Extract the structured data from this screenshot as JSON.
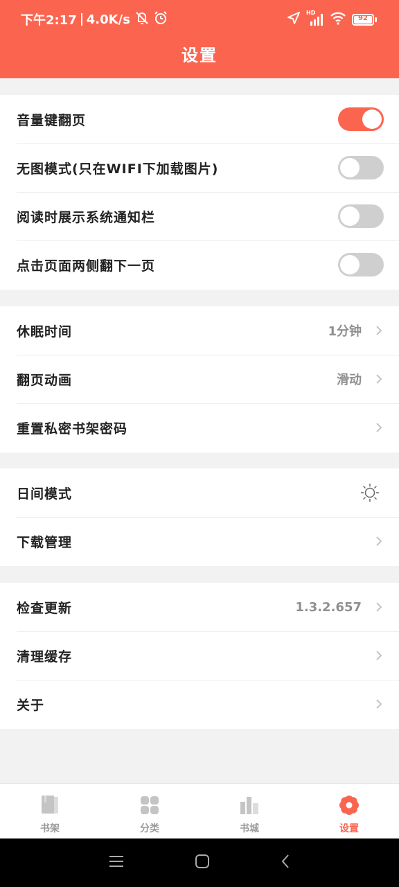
{
  "status_bar": {
    "time": "下午2:17",
    "speed": "4.0K/s",
    "network": "HD",
    "battery": "92"
  },
  "header": {
    "title": "设置"
  },
  "groups": [
    {
      "rows": [
        {
          "label": "音量键翻页",
          "toggle": true
        },
        {
          "label": "无图模式(只在WIFI下加载图片)",
          "toggle": false
        },
        {
          "label": "阅读时展示系统通知栏",
          "toggle": false
        },
        {
          "label": "点击页面两侧翻下一页",
          "toggle": false
        }
      ]
    },
    {
      "rows": [
        {
          "label": "休眠时间",
          "value": "1分钟"
        },
        {
          "label": "翻页动画",
          "value": "滑动"
        },
        {
          "label": "重置私密书架密码"
        }
      ]
    },
    {
      "rows": [
        {
          "label": "日间模式",
          "icon": "sun-icon"
        },
        {
          "label": "下载管理"
        }
      ]
    },
    {
      "rows": [
        {
          "label": "检查更新",
          "value": "1.3.2.657"
        },
        {
          "label": "清理缓存"
        },
        {
          "label": "关于"
        }
      ]
    }
  ],
  "tabbar": {
    "tabs": [
      {
        "label": "书架",
        "icon": "bookshelf-icon",
        "active": false
      },
      {
        "label": "分类",
        "icon": "category-icon",
        "active": false
      },
      {
        "label": "书城",
        "icon": "bookstore-icon",
        "active": false
      },
      {
        "label": "设置",
        "icon": "settings-flower-icon",
        "active": true
      }
    ]
  },
  "colors": {
    "accent": "#fb6550",
    "toggle_off": "#cfcfcf",
    "muted_text": "#8f8f8f",
    "inactive_icon": "#c4c4c4"
  }
}
